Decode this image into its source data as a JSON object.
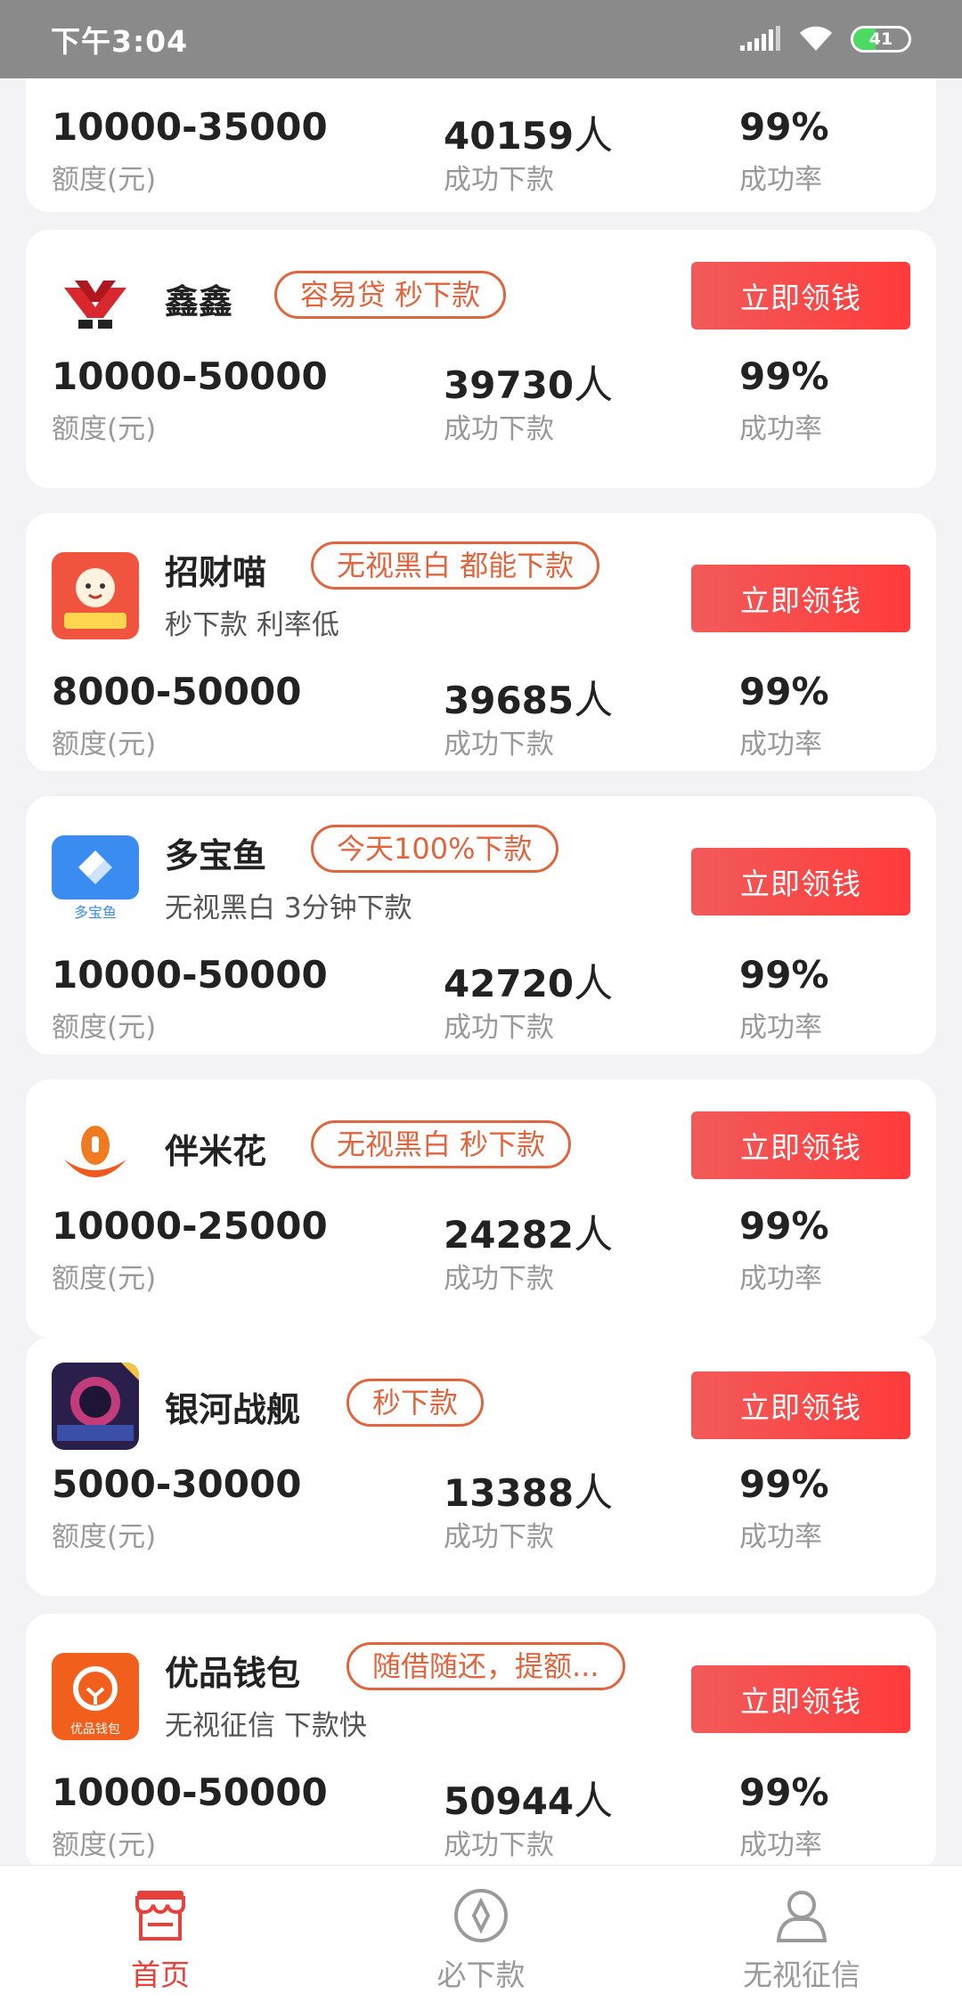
{
  "status_bar": {
    "time": "下午3:04",
    "battery": "41",
    "battery_level": 0.41
  },
  "top_card": {
    "amount": "10000-35000",
    "amount_label": "额度(元)",
    "count": "40159",
    "count_unit": "人",
    "count_label": "成功下款",
    "rate": "99%",
    "rate_label": "成功率"
  },
  "cards": [
    {
      "name": "鑫鑫",
      "tag": "容易贷 秒下款",
      "subtitle": "",
      "cta": "立即领钱",
      "amount": "10000-50000",
      "amount_label": "额度(元)",
      "count": "39730",
      "count_unit": "人",
      "count_label": "成功下款",
      "rate": "99%",
      "rate_label": "成功率",
      "logo": "xinxin-logo"
    },
    {
      "name": "招财喵",
      "tag": "无视黑白 都能下款",
      "subtitle": "秒下款 利率低",
      "cta": "立即领钱",
      "amount": "8000-50000",
      "amount_label": "额度(元)",
      "count": "39685",
      "count_unit": "人",
      "count_label": "成功下款",
      "rate": "99%",
      "rate_label": "成功率",
      "logo": "zhaocaimiao-logo"
    },
    {
      "name": "多宝鱼",
      "tag": "今天100%下款",
      "subtitle": "无视黑白 3分钟下款",
      "cta": "立即领钱",
      "amount": "10000-50000",
      "amount_label": "额度(元)",
      "count": "42720",
      "count_unit": "人",
      "count_label": "成功下款",
      "rate": "99%",
      "rate_label": "成功率",
      "logo": "duobaoyu-logo",
      "logo_text": "多宝鱼"
    },
    {
      "name": "伴米花",
      "tag": "无视黑白 秒下款",
      "subtitle": "",
      "cta": "立即领钱",
      "amount": "10000-25000",
      "amount_label": "额度(元)",
      "count": "24282",
      "count_unit": "人",
      "count_label": "成功下款",
      "rate": "99%",
      "rate_label": "成功率",
      "logo": "banmihua-logo"
    },
    {
      "name": "银河战舰",
      "tag": "秒下款",
      "subtitle": "",
      "cta": "立即领钱",
      "amount": "5000-30000",
      "amount_label": "额度(元)",
      "count": "13388",
      "count_unit": "人",
      "count_label": "成功下款",
      "rate": "99%",
      "rate_label": "成功率",
      "logo": "yinhezhanjian-logo"
    },
    {
      "name": "优品钱包",
      "tag": "随借随还，提额...",
      "subtitle": "无视征信 下款快",
      "cta": "立即领钱",
      "amount": "10000-50000",
      "amount_label": "额度(元)",
      "count": "50944",
      "count_unit": "人",
      "count_label": "成功下款",
      "rate": "99%",
      "rate_label": "成功率",
      "logo": "youpinqianbao-logo",
      "logo_text": "优品钱包"
    }
  ],
  "tabbar": [
    {
      "label": "首页",
      "icon": "shop-icon",
      "active": true
    },
    {
      "label": "必下款",
      "icon": "compass-icon",
      "active": false
    },
    {
      "label": "无视征信",
      "icon": "user-icon",
      "active": false
    }
  ],
  "colors": {
    "accent": "#e8413b",
    "tag": "#e0653e",
    "cta_start": "#f25a5a",
    "cta_end": "#ff3b3b"
  }
}
